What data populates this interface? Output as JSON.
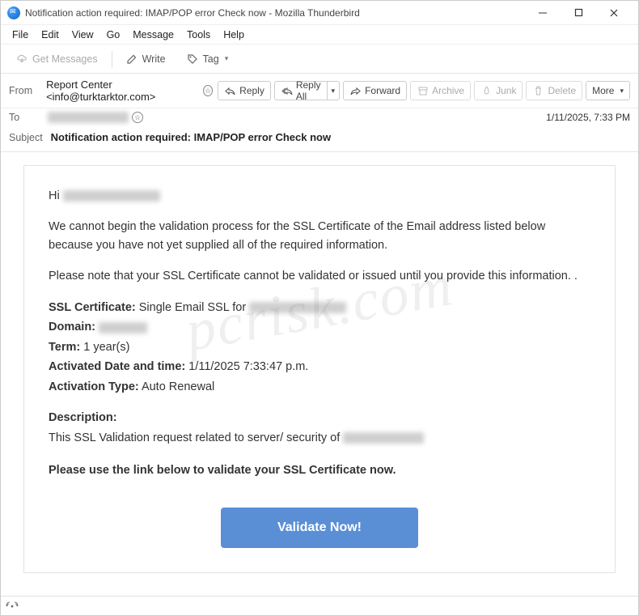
{
  "window": {
    "title": "Notification action required: IMAP/POP error Check now - Mozilla Thunderbird"
  },
  "menu": {
    "file": "File",
    "edit": "Edit",
    "view": "View",
    "go": "Go",
    "message": "Message",
    "tools": "Tools",
    "help": "Help"
  },
  "toolbar": {
    "get_messages": "Get Messages",
    "write": "Write",
    "tag": "Tag"
  },
  "actions": {
    "reply": "Reply",
    "reply_all": "Reply All",
    "forward": "Forward",
    "archive": "Archive",
    "junk": "Junk",
    "delete": "Delete",
    "more": "More"
  },
  "headers": {
    "from_label": "From",
    "from_value": "Report Center <info@turktarktor.com>",
    "to_label": "To",
    "subject_label": "Subject",
    "subject_value": "Notification action required: IMAP/POP error Check now",
    "timestamp": "1/11/2025, 7:33 PM"
  },
  "email": {
    "greeting_prefix": "Hi ",
    "p1": "We cannot begin the validation process for the SSL Certificate of the Email address listed below because you have not yet supplied all of the required information.",
    "p2": "Please note that your SSL Certificate cannot be validated or issued until you provide this information. .",
    "ssl_cert_label": "SSL Certificate:",
    "ssl_cert_value": " Single Email SSL for ",
    "domain_label": "Domain:",
    "term_label": "Term:",
    "term_value": " 1 year(s)",
    "activated_label": "Activated Date and time:",
    "activated_value": " 1/11/2025 7:33:47 p.m.",
    "activation_type_label": "Activation Type:",
    "activation_type_value": " Auto Renewal",
    "description_label": "Description:",
    "description_text": "This SSL Validation request related to server/ security of ",
    "cta_instruction": "Please use the link below to validate your SSL Certificate now.",
    "cta_button": "Validate Now!"
  },
  "status": {
    "indicator": "((•))"
  },
  "colors": {
    "cta_bg": "#5a8fd6"
  }
}
